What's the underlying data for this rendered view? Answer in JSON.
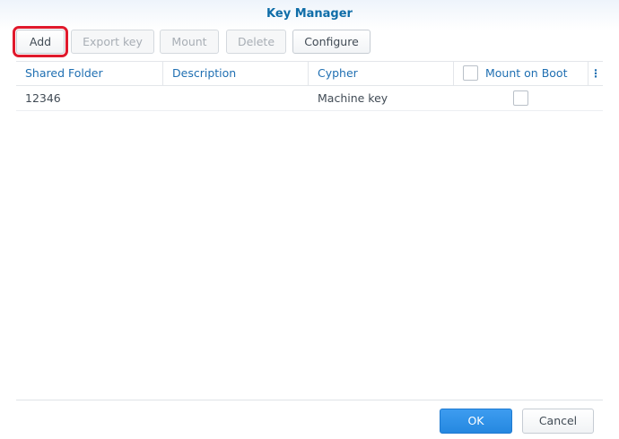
{
  "window": {
    "title": "Key Manager"
  },
  "toolbar": {
    "add": "Add",
    "export_key": "Export key",
    "mount": "Mount",
    "delete": "Delete",
    "configure": "Configure"
  },
  "grid": {
    "columns": {
      "shared_folder": "Shared Folder",
      "description": "Description",
      "cypher": "Cypher",
      "mount_on_boot": "Mount on Boot"
    },
    "rows": [
      {
        "shared_folder": "12346",
        "description": "",
        "cypher": "Machine key",
        "mount_on_boot": false
      }
    ],
    "more_icon": "vertical-ellipsis-icon"
  },
  "footer": {
    "ok": "OK",
    "cancel": "Cancel"
  },
  "colors": {
    "accent": "#0f6da8",
    "primary_button": "#2588e0",
    "highlight": "#e0192c"
  }
}
